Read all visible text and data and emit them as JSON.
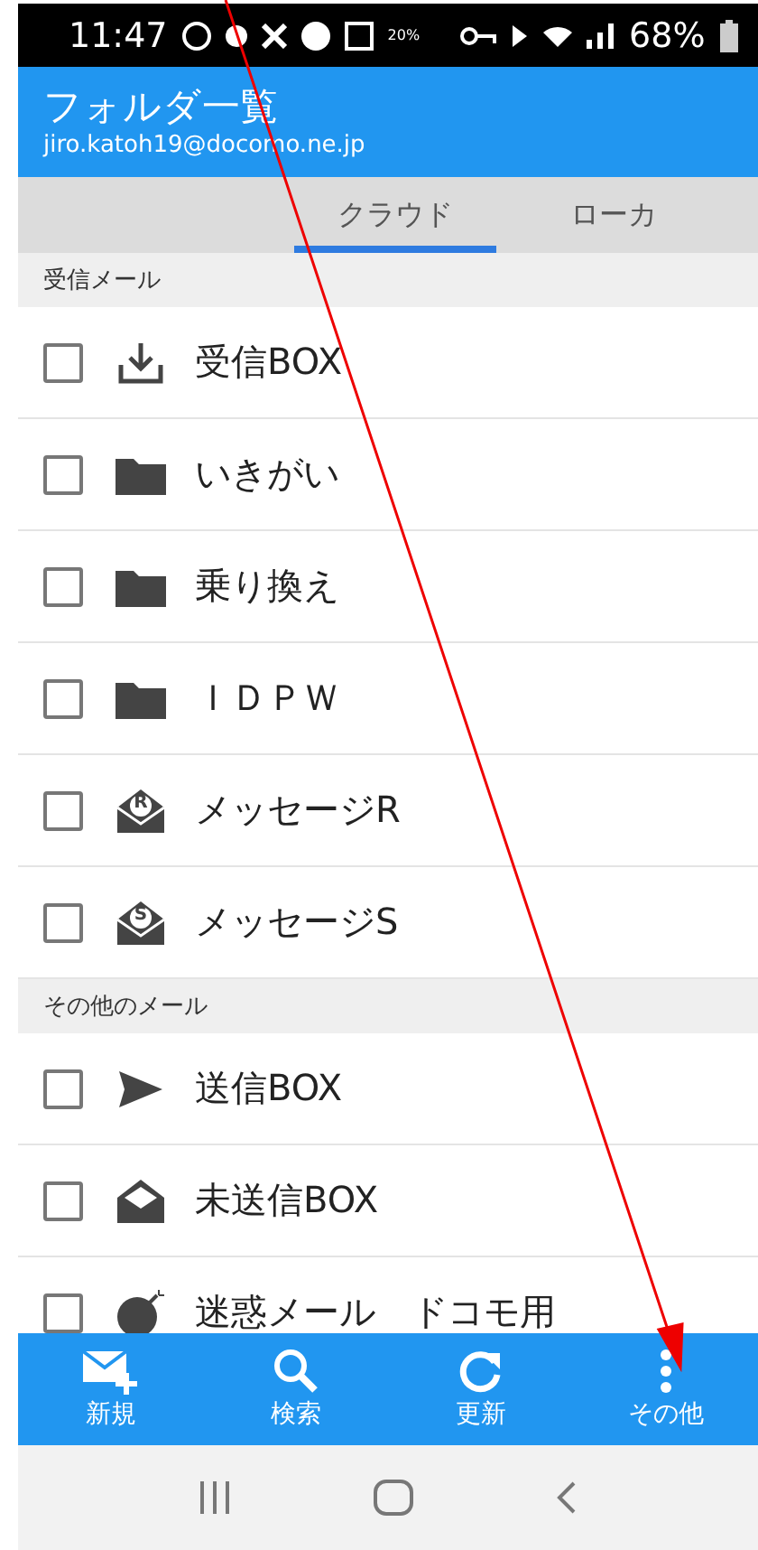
{
  "status_bar": {
    "time": "11:47",
    "weather": "20%",
    "battery": "68%"
  },
  "header": {
    "title": "フォルダ一覧",
    "account": "jiro.katoh19@docomo.ne.jp"
  },
  "tabs": [
    {
      "label": "クラウド",
      "selected": true
    },
    {
      "label": "ローカ",
      "selected": false
    }
  ],
  "sections": [
    {
      "title": "受信メール",
      "folders": [
        {
          "name": "受信BOX",
          "kind": "inbox",
          "checked": false
        },
        {
          "name": "いきがい",
          "kind": "folder",
          "checked": false
        },
        {
          "name": "乗り換え",
          "kind": "folder",
          "checked": false
        },
        {
          "name": "ＩＤＰＷ",
          "kind": "folder",
          "checked": false
        },
        {
          "name": "メッセージR",
          "kind": "lettered",
          "letter": "R",
          "checked": false
        },
        {
          "name": "メッセージS",
          "kind": "lettered",
          "letter": "S",
          "checked": false
        }
      ]
    },
    {
      "title": "その他のメール",
      "folders": [
        {
          "name": "送信BOX",
          "kind": "sent",
          "checked": false
        },
        {
          "name": "未送信BOX",
          "kind": "unsent",
          "checked": false
        },
        {
          "name": "迷惑メール　ドコモ用",
          "kind": "spam",
          "checked": false
        }
      ]
    }
  ],
  "toolbar": [
    {
      "label": "新規",
      "kind": "compose"
    },
    {
      "label": "検索",
      "kind": "search"
    },
    {
      "label": "更新",
      "kind": "refresh"
    },
    {
      "label": "その他",
      "kind": "more"
    }
  ],
  "annotation": {
    "kind": "arrow"
  }
}
